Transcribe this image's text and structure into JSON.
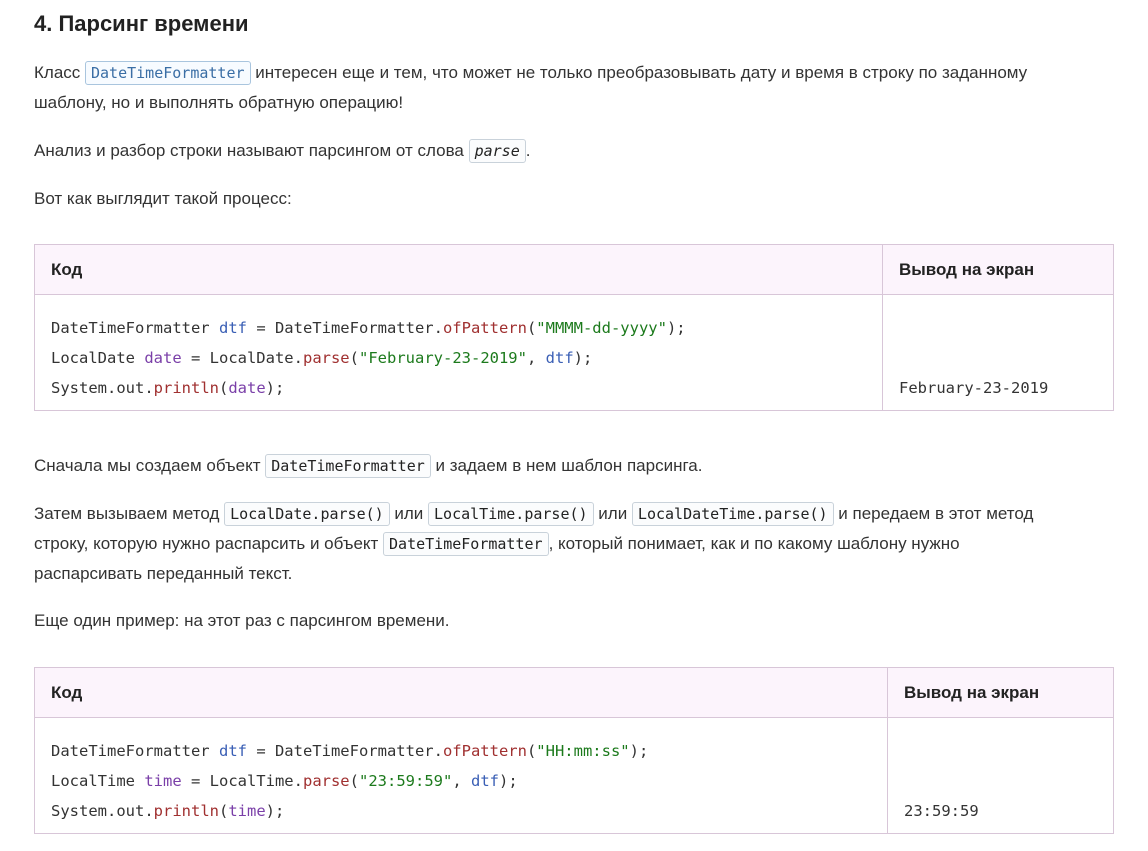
{
  "heading": "4. Парсинг времени",
  "para1": {
    "before": "Класс ",
    "code": "DateTimeFormatter",
    "after_line1": " интересен еще и тем, что может не только преобразовывать дату и время в строку по заданному",
    "line2": "шаблону, но и выполнять обратную операцию!"
  },
  "para2": {
    "before": "Анализ и разбор строки называют парсингом от слова ",
    "code": "parse",
    "after": "."
  },
  "para3": "Вот как выглядит такой процесс:",
  "table1": {
    "col_code": "Код",
    "col_output": "Вывод на экран",
    "line1": {
      "a": "DateTimeFormatter ",
      "var": "dtf",
      "b": " = DateTimeFormatter.",
      "method": "ofPattern",
      "c": "(",
      "str": "\"MMMM-dd-yyyy\"",
      "d": ");"
    },
    "line2": {
      "a": "LocalDate ",
      "var": "date",
      "b": " = LocalDate.",
      "method": "parse",
      "c": "(",
      "str": "\"February-23-2019\"",
      "d": ", ",
      "var2": "dtf",
      "e": ");"
    },
    "line3": {
      "a": "System.out.",
      "method": "println",
      "c": "(",
      "var": "date",
      "d": ");"
    },
    "output": "February-23-2019"
  },
  "para4": {
    "before": "Сначала мы создаем объект ",
    "code": "DateTimeFormatter",
    "after": " и задаем в нем шаблон парсинга."
  },
  "para5": {
    "t1": "Затем вызываем метод ",
    "c1": "LocalDate.parse()",
    "t2": " или ",
    "c2": "LocalTime.parse()",
    "t3": " или ",
    "c3": "LocalDateTime.parse()",
    "t4": " и передаем в этот метод",
    "t5": "строку, которую нужно распарсить и объект ",
    "c4": "DateTimeFormatter",
    "t6": ", который понимает, как и по какому шаблону нужно",
    "t7": "распарсивать переданный текст."
  },
  "para6": "Еще один пример: на этот раз с парсингом времени.",
  "table2": {
    "col_code": "Код",
    "col_output": "Вывод на экран",
    "line1": {
      "a": "DateTimeFormatter ",
      "var": "dtf",
      "b": " = DateTimeFormatter.",
      "method": "ofPattern",
      "c": "(",
      "str": "\"HH:mm:ss\"",
      "d": ");"
    },
    "line2": {
      "a": "LocalTime ",
      "var": "time",
      "b": " = LocalTime.",
      "method": "parse",
      "c": "(",
      "str": "\"23:59:59\"",
      "d": ", ",
      "var2": "dtf",
      "e": ");"
    },
    "line3": {
      "a": "System.out.",
      "method": "println",
      "c": "(",
      "var": "time",
      "d": ");"
    },
    "output": "23:59:59"
  }
}
